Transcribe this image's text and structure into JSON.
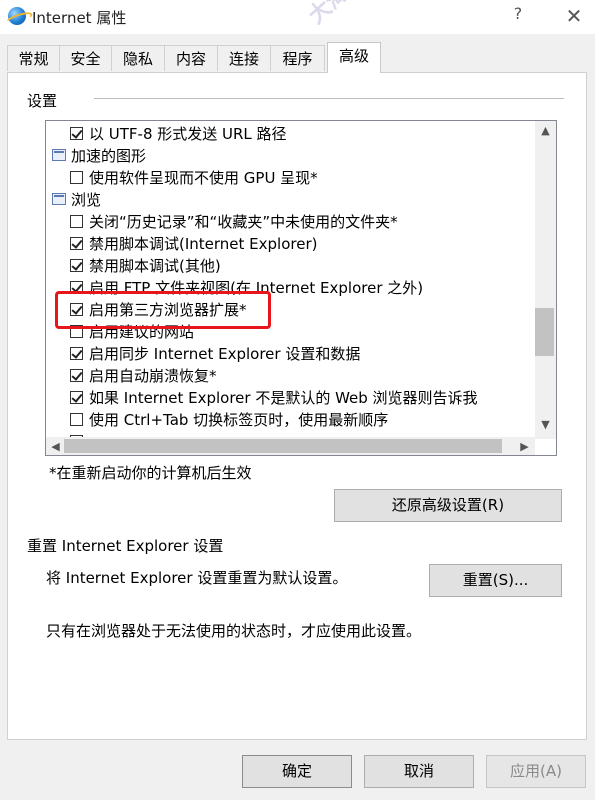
{
  "window": {
    "title": "Internet 属性",
    "help": "?",
    "close": "✕"
  },
  "watermark": "大海资源库 vip.lzzcc.",
  "tabs": [
    "常规",
    "安全",
    "隐私",
    "内容",
    "连接",
    "程序",
    "高级"
  ],
  "active_tab": "高级",
  "settings": {
    "label": "设置",
    "rows": [
      {
        "type": "checkbox",
        "checked": true,
        "indent": 1,
        "text": "以 UTF-8 形式发送 URL 路径"
      },
      {
        "type": "group",
        "indent": 0,
        "text": "加速的图形"
      },
      {
        "type": "checkbox",
        "checked": false,
        "indent": 1,
        "text": "使用软件呈现而不使用 GPU 呈现*"
      },
      {
        "type": "group",
        "indent": 0,
        "text": "浏览"
      },
      {
        "type": "checkbox",
        "checked": false,
        "indent": 1,
        "text": "关闭“历史记录”和“收藏夹”中未使用的文件夹*"
      },
      {
        "type": "checkbox",
        "checked": true,
        "indent": 1,
        "text": "禁用脚本调试(Internet Explorer)"
      },
      {
        "type": "checkbox",
        "checked": true,
        "indent": 1,
        "text": "禁用脚本调试(其他)"
      },
      {
        "type": "checkbox",
        "checked": true,
        "indent": 1,
        "text": "启用 FTP 文件夹视图(在 Internet Explorer 之外)"
      },
      {
        "type": "checkbox",
        "checked": true,
        "indent": 1,
        "text": "启用第三方浏览器扩展*"
      },
      {
        "type": "checkbox",
        "checked": false,
        "indent": 1,
        "text": "启用建议的网站"
      },
      {
        "type": "checkbox",
        "checked": true,
        "indent": 1,
        "text": "启用同步 Internet Explorer 设置和数据"
      },
      {
        "type": "checkbox",
        "checked": true,
        "indent": 1,
        "text": "启用自动崩溃恢复*"
      },
      {
        "type": "checkbox",
        "checked": true,
        "indent": 1,
        "text": "如果 Internet Explorer 不是默认的 Web 浏览器则告诉我"
      },
      {
        "type": "checkbox",
        "checked": false,
        "indent": 1,
        "text": "使用 Ctrl+Tab 切换标签页时，使用最新顺序"
      },
      {
        "type": "checkbox",
        "checked": false,
        "indent": 1,
        "text": ""
      }
    ],
    "note": "*在重新启动你的计算机后生效",
    "restore_button": "还原高级设置(R)"
  },
  "reset": {
    "label": "重置 Internet Explorer 设置",
    "description": "将 Internet Explorer 设置重置为默认设置。",
    "button": "重置(S)...",
    "hint": "只有在浏览器处于无法使用的状态时，才应使用此设置。"
  },
  "footer": {
    "ok": "确定",
    "cancel": "取消",
    "apply": "应用(A)"
  },
  "scroll_arrows": {
    "up": "▲",
    "down": "▼",
    "left": "◀",
    "right": "▶"
  },
  "highlight_color": "#e8151b"
}
